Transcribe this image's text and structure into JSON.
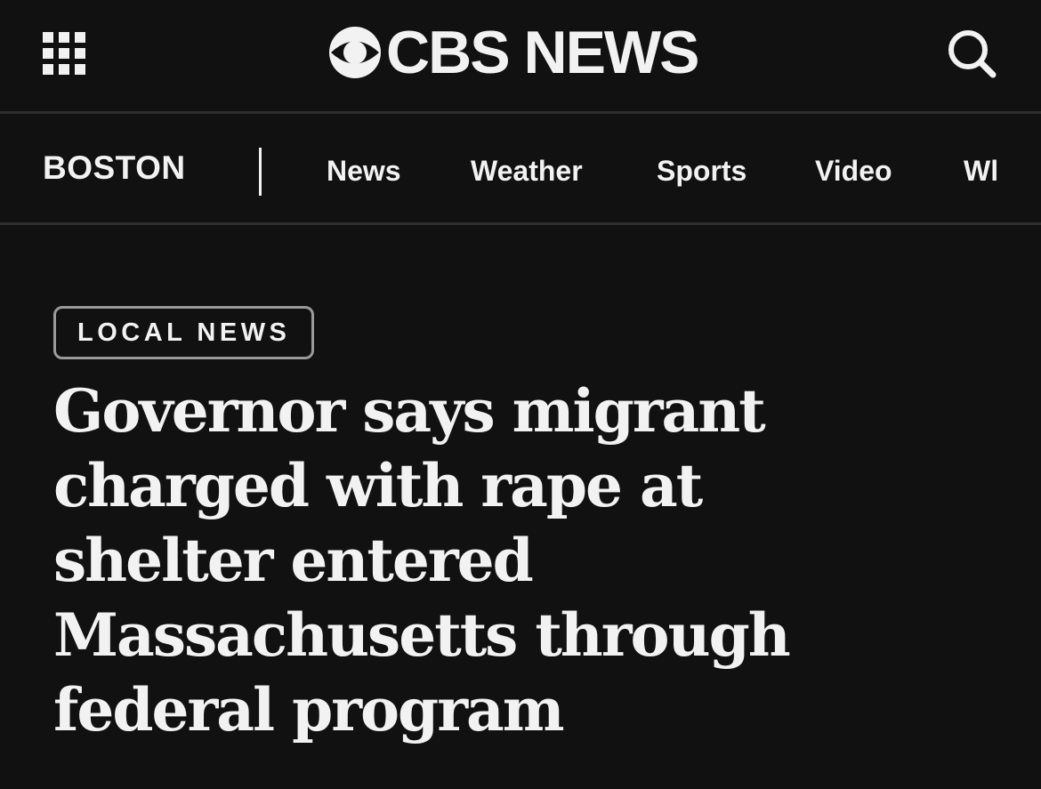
{
  "header": {
    "logo_text": "CBS NEWS",
    "menu_icon": "grid-menu-icon",
    "search_icon": "search-icon",
    "logo_icon": "cbs-eye-icon"
  },
  "section_nav": {
    "section_title": "BOSTON",
    "items": [
      {
        "label": "News"
      },
      {
        "label": "Weather"
      },
      {
        "label": "Sports"
      },
      {
        "label": "Video"
      },
      {
        "label": "Wl"
      }
    ]
  },
  "article": {
    "category": "LOCAL NEWS",
    "headline_lines": [
      "Governor says migrant",
      "charged with rape at",
      "shelter entered",
      "Massachusetts through",
      "federal program"
    ]
  },
  "colors": {
    "background": "#111111",
    "text": "#f2f2f2",
    "divider": "#2e2e2e",
    "badge_border": "#9a9a9a"
  }
}
